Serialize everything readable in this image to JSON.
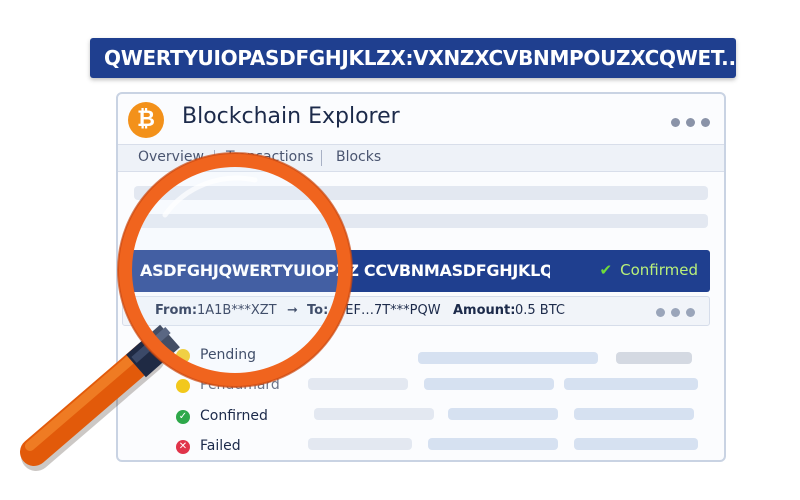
{
  "header": {
    "hash": "QWERTYUIOPASDFGHJKLZX:VXNZXCVBNMPOUZXCQWET..."
  },
  "app": {
    "title": "Blockchain Explorer",
    "logo_symbol": "₿",
    "logo_color": "#f3911a"
  },
  "nav": {
    "tabs": [
      {
        "label": "Overview"
      },
      {
        "label": "Transactions"
      },
      {
        "label": "Blocks"
      }
    ]
  },
  "transaction": {
    "hash": "ASDFGHJQWERTYUIOPZZ  CCVBNMASDFGHJKLQWE...",
    "status": "Confirmed",
    "status_icon": "check-icon",
    "from_label": "From:",
    "from_value": "1A1B***XZT",
    "arrow": "➞",
    "to_label": "To:",
    "to_value": "3EF…7T***PQW",
    "amount_label": "Amount:",
    "amount_value": "0.5 BTC"
  },
  "status_legend": [
    {
      "label": "Pending",
      "color": "#f2c81c",
      "icon": "pending-dot-icon"
    },
    {
      "label": "Pendumard",
      "color": "#f2c81c",
      "icon": "pending-dot-icon"
    },
    {
      "label": "Confirned",
      "color": "#2ea84a",
      "icon": "check-icon"
    },
    {
      "label": "Failed",
      "color": "#e0344a",
      "icon": "x-icon"
    }
  ],
  "colors": {
    "primary": "#1f3f8f",
    "confirmed": "#6fdc3a",
    "magnifier_rim": "#f0641e",
    "magnifier_handle": "#f26b12"
  }
}
